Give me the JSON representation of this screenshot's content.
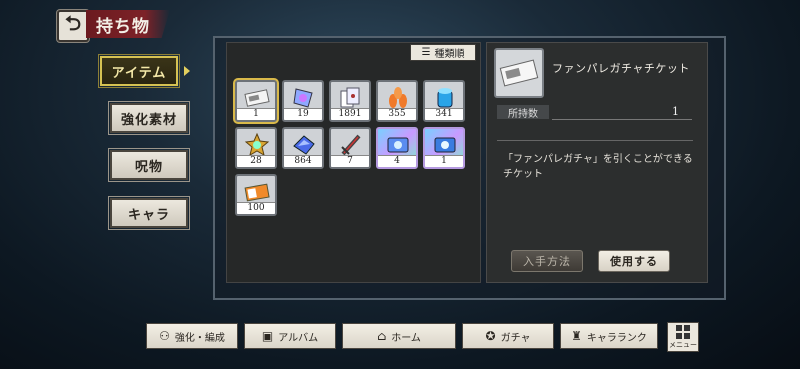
{
  "header": {
    "back_icon": "back-arrow-icon",
    "title": "持ち物"
  },
  "tabs": [
    {
      "label": "アイテム",
      "active": true
    },
    {
      "label": "強化素材",
      "active": false
    },
    {
      "label": "呪物",
      "active": false
    },
    {
      "label": "キャラ",
      "active": false
    }
  ],
  "sort": {
    "label": "種類順",
    "icon": "sort-icon"
  },
  "items": [
    {
      "count": "1",
      "icon": "gacha-ticket-icon",
      "selected": true
    },
    {
      "count": "19",
      "icon": "crystal-tag-icon"
    },
    {
      "count": "1891",
      "icon": "cards-icon"
    },
    {
      "count": "355",
      "icon": "orange-leaves-icon"
    },
    {
      "count": "341",
      "icon": "blue-crystal-icon"
    },
    {
      "count": "28",
      "icon": "gold-medal-icon"
    },
    {
      "count": "864",
      "icon": "blue-gem-icon"
    },
    {
      "count": "7",
      "icon": "sword-icon"
    },
    {
      "count": "4",
      "icon": "rainbow-ticket-icon",
      "rainbow": true
    },
    {
      "count": "1",
      "icon": "rainbow-ticket-icon",
      "rainbow": true
    },
    {
      "count": "100",
      "icon": "orange-ticket-icon"
    }
  ],
  "detail": {
    "name": "ファンパレガチャチケット",
    "owned_label": "所持数",
    "owned_value": "1",
    "description": "「ファンパレガチャ」を引くことができるチケット",
    "how_to_get": "入手方法",
    "use": "使用する"
  },
  "nav": [
    {
      "label": "強化・編成",
      "icon": "people-icon"
    },
    {
      "label": "アルバム",
      "icon": "album-icon"
    },
    {
      "label": "ホーム",
      "icon": "home-icon"
    },
    {
      "label": "ガチャ",
      "icon": "gacha-icon"
    },
    {
      "label": "キャラランク",
      "icon": "rank-icon"
    }
  ],
  "menu": {
    "label": "メニュー",
    "icon": "grid-menu-icon"
  },
  "colors": {
    "accent_gold": "#d6c253",
    "title_red": "#7d2228"
  }
}
